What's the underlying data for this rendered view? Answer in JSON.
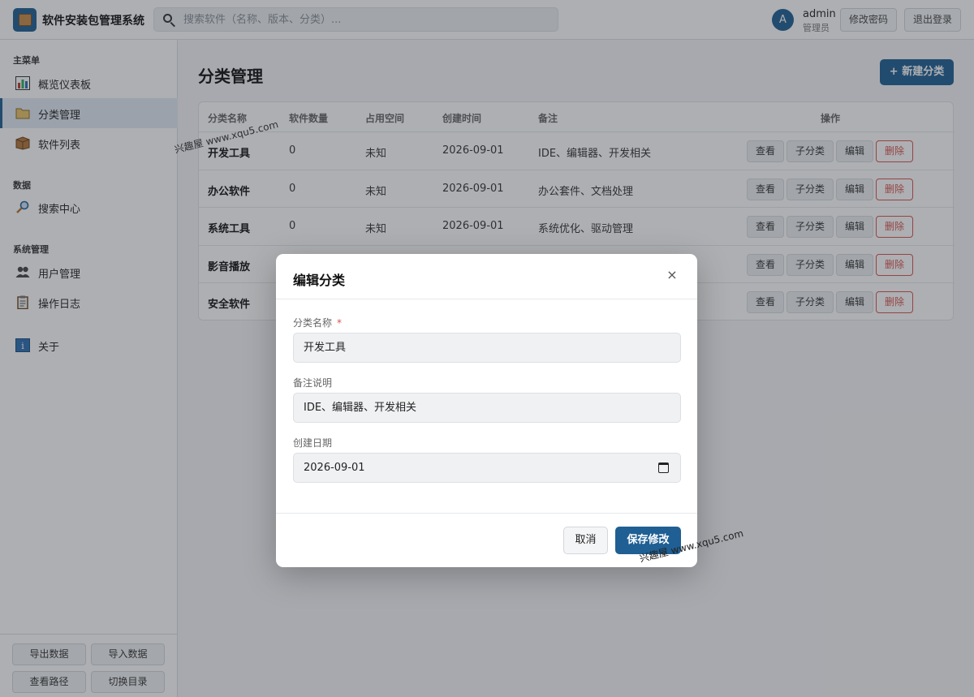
{
  "app": {
    "title": "软件安装包管理系统"
  },
  "search": {
    "placeholder": "搜索软件（名称、版本、分类）..."
  },
  "user": {
    "avatar_letter": "A",
    "name": "admin",
    "role": "管理员"
  },
  "header_buttons": {
    "change_password": "修改密码",
    "logout": "退出登录"
  },
  "sidebar": {
    "sections": [
      {
        "title": "主菜单",
        "items": [
          {
            "label": "概览仪表板",
            "icon": "bar-chart-icon"
          },
          {
            "label": "分类管理",
            "icon": "folder-icon",
            "active": true
          },
          {
            "label": "软件列表",
            "icon": "package-box-icon"
          }
        ]
      },
      {
        "title": "数据",
        "items": [
          {
            "label": "搜索中心",
            "icon": "magnifier-icon"
          }
        ]
      },
      {
        "title": "系统管理",
        "items": [
          {
            "label": "用户管理",
            "icon": "users-icon"
          },
          {
            "label": "操作日志",
            "icon": "clipboard-icon"
          }
        ]
      }
    ],
    "about": {
      "label": "关于",
      "icon": "info-icon"
    },
    "bottom_buttons": {
      "export": "导出数据",
      "import": "导入数据",
      "view_path": "查看路径",
      "switch_dir": "切换目录"
    }
  },
  "page": {
    "title": "分类管理",
    "new_button": "+ 新建分类"
  },
  "table": {
    "headers": [
      "分类名称",
      "软件数量",
      "占用空间",
      "创建时间",
      "备注",
      "操作"
    ],
    "rows": [
      {
        "name": "开发工具",
        "count": "0",
        "space": "未知",
        "created": "2026-09-01",
        "note": "IDE、编辑器、开发相关"
      },
      {
        "name": "办公软件",
        "count": "0",
        "space": "未知",
        "created": "2026-09-01",
        "note": "办公套件、文档处理"
      },
      {
        "name": "系统工具",
        "count": "0",
        "space": "未知",
        "created": "2026-09-01",
        "note": "系统优化、驱动管理"
      },
      {
        "name": "影音播放",
        "count": "",
        "space": "",
        "created": "",
        "note": ""
      },
      {
        "name": "安全软件",
        "count": "",
        "space": "",
        "created": "",
        "note": ""
      }
    ],
    "actions": {
      "view": "查看",
      "subcategory": "子分类",
      "edit": "编辑",
      "delete": "删除"
    }
  },
  "modal": {
    "title": "编辑分类",
    "close": "×",
    "fields": {
      "name": {
        "label": "分类名称",
        "required_mark": "*",
        "value": "开发工具"
      },
      "note": {
        "label": "备注说明",
        "value": "IDE、编辑器、开发相关"
      },
      "date": {
        "label": "创建日期",
        "value": "2026-09-01"
      }
    },
    "cancel": "取消",
    "save": "保存修改"
  },
  "watermark": {
    "text": "兴趣屋 www.xqu5.com"
  }
}
